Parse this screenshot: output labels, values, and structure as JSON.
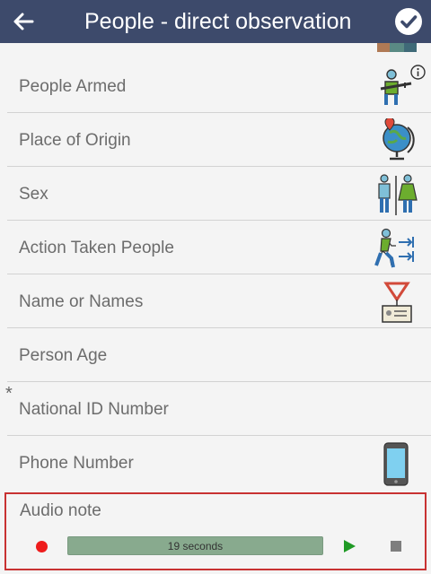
{
  "header": {
    "title": "People - direct observation",
    "back_icon": "arrow-left-icon",
    "confirm_icon": "check-circle-icon",
    "background": "#3d4a6b"
  },
  "fields": [
    {
      "label": "People Armed",
      "icon": "armed-person-icon",
      "has_info": true,
      "required": false
    },
    {
      "label": "Place of Origin",
      "icon": "globe-pin-icon",
      "has_info": false,
      "required": false
    },
    {
      "label": "Sex",
      "icon": "male-female-icon",
      "has_info": false,
      "required": false
    },
    {
      "label": "Action Taken People",
      "icon": "person-walking-arrows-icon",
      "has_info": false,
      "required": false
    },
    {
      "label": "Name or Names",
      "icon": "id-badge-icon",
      "has_info": false,
      "required": false
    },
    {
      "label": "Person Age",
      "icon": "",
      "has_info": false,
      "required": false
    },
    {
      "label": "National ID Number",
      "icon": "",
      "has_info": false,
      "required": true,
      "required_mark": "*"
    },
    {
      "label": "Phone Number",
      "icon": "smartphone-icon",
      "has_info": false,
      "required": false
    }
  ],
  "audio": {
    "label": "Audio note",
    "duration_text": "19 seconds",
    "record_icon": "record-icon",
    "play_icon": "play-icon",
    "stop_icon": "stop-icon",
    "highlight_color": "#c83232"
  }
}
